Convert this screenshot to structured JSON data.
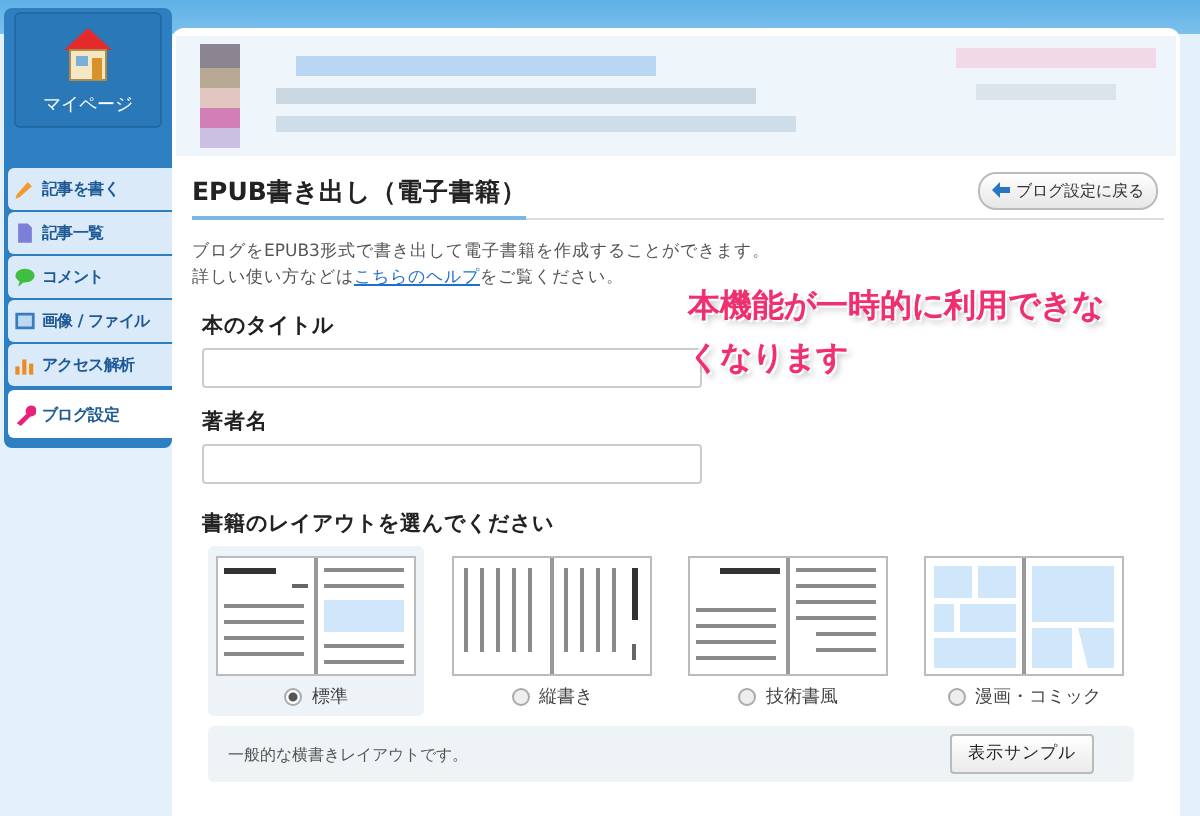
{
  "sidebar": {
    "mypage": "マイページ",
    "items": [
      {
        "label": "記事を書く",
        "selected": false
      },
      {
        "label": "記事一覧",
        "selected": false
      },
      {
        "label": "コメント",
        "selected": false
      },
      {
        "label": "画像 / ファイル",
        "selected": false
      },
      {
        "label": "アクセス解析",
        "selected": false
      },
      {
        "label": "ブログ設定",
        "selected": true
      }
    ]
  },
  "page": {
    "title": "EPUB書き出し（電子書籍）",
    "back_button": "ブログ設定に戻る",
    "description": "ブログをEPUB3形式で書き出して電子書籍を作成することができます。",
    "help": {
      "before": "詳しい使い方などは",
      "link": "こちらのヘルプ",
      "after": "をご覧ください。"
    },
    "notice": "本機能が一時的に利用できなくなります",
    "fields": [
      {
        "label": "本のタイトル"
      },
      {
        "label": "著者名"
      }
    ],
    "layout": {
      "label": "書籍のレイアウトを選んでください",
      "options": [
        {
          "label": "標準",
          "kind": "horizontal",
          "selected": true
        },
        {
          "label": "縦書き",
          "kind": "vertical",
          "selected": false
        },
        {
          "label": "技術書風",
          "kind": "technical",
          "selected": false
        },
        {
          "label": "漫画・コミック",
          "kind": "comic",
          "selected": false
        }
      ],
      "description": "一般的な横書きレイアウトです。",
      "sample_button": "表示サンプル"
    }
  }
}
